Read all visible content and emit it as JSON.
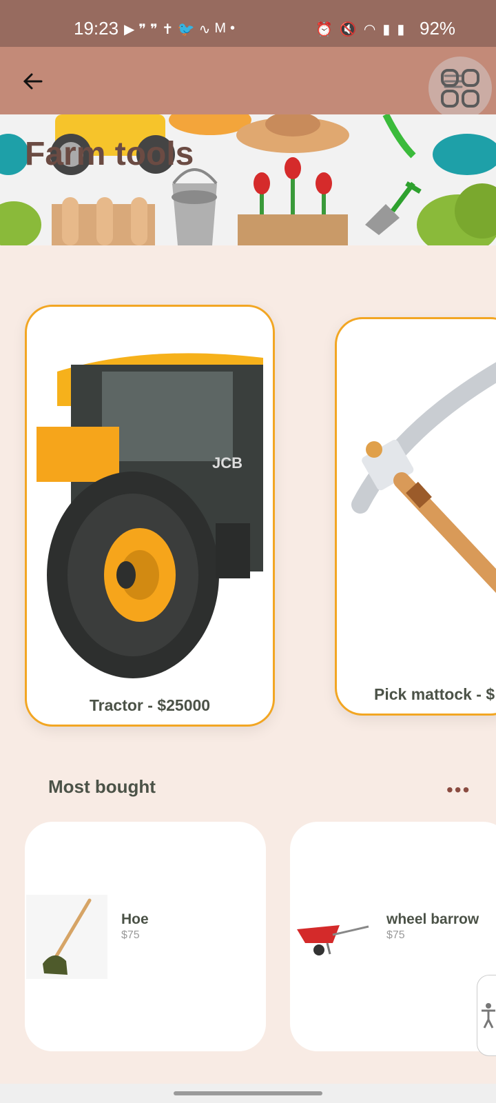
{
  "status": {
    "time": "19:23",
    "battery": "92%",
    "left_icons": [
      "youtube-icon",
      "quote-icon",
      "quote-icon",
      "bible-icon",
      "twitter-icon",
      "activity-icon",
      "mail-icon",
      "dot-icon"
    ],
    "right_icons": [
      "alarm-icon",
      "mute-icon",
      "wifi-icon",
      "signal-icon",
      "signal-icon",
      "battery-icon"
    ]
  },
  "appbar": {
    "back_icon": "arrow-left-icon",
    "menu_icon": "hamburger-icon",
    "overlay_icon": "apps-grid-icon"
  },
  "hero": {
    "title": "Farm tools"
  },
  "carousel": [
    {
      "caption": "Tractor - $25000",
      "image": "tractor-image"
    },
    {
      "caption": "Pick mattock - $",
      "image": "pick-mattock-image"
    }
  ],
  "most_bought": {
    "title": "Most bought",
    "more_icon": "more-horizontal-icon",
    "items": [
      {
        "name": "Hoe",
        "price": "$75",
        "image": "hoe-image"
      },
      {
        "name": "wheel barrow",
        "price": "$75",
        "image": "wheelbarrow-image"
      }
    ]
  },
  "accessibility_icon": "accessibility-icon",
  "colors": {
    "accent": "#f2a623",
    "appbar": "#c38a78",
    "statusbar": "#976b5f",
    "background": "#f8ebe4"
  }
}
